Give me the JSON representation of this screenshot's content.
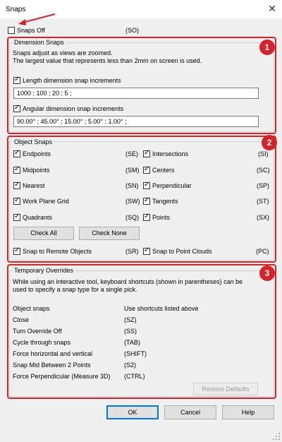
{
  "window": {
    "title": "Snaps",
    "close_glyph": "✕"
  },
  "snaps_off": {
    "label": "Snaps Off",
    "shortcut": "(SO)",
    "checked": false
  },
  "dimension": {
    "legend": "Dimension Snaps",
    "desc1": "Snaps adjust as views are zoomed.",
    "desc2": "The largest value that represents less than 2mm on screen is used.",
    "length_label": "Length dimension snap increments",
    "length_value": "1000 ; 100 ; 20 ; 5 ;",
    "angular_label": "Angular dimension snap increments",
    "angular_value": "90.00° ; 45.00° ; 15.00° ; 5.00° ; 1.00° ;"
  },
  "object": {
    "legend": "Object Snaps",
    "left": [
      {
        "label": "Endpoints",
        "shortcut": "(SE)"
      },
      {
        "label": "Midpoints",
        "shortcut": "(SM)"
      },
      {
        "label": "Nearest",
        "shortcut": "(SN)"
      },
      {
        "label": "Work Plane Grid",
        "shortcut": "(SW)"
      },
      {
        "label": "Quadrants",
        "shortcut": "(SQ)"
      }
    ],
    "right": [
      {
        "label": "Intersections",
        "shortcut": "(SI)"
      },
      {
        "label": "Centers",
        "shortcut": "(SC)"
      },
      {
        "label": "Perpendicular",
        "shortcut": "(SP)"
      },
      {
        "label": "Tangents",
        "shortcut": "(ST)"
      },
      {
        "label": "Points",
        "shortcut": "(SX)"
      }
    ],
    "check_all": "Check All",
    "check_none": "Check None",
    "remote": {
      "label": "Snap to Remote Objects",
      "shortcut": "(SR)"
    },
    "clouds": {
      "label": "Snap to Point Clouds",
      "shortcut": "(PC)"
    }
  },
  "temporary": {
    "legend": "Temporary Overrides",
    "desc1": "While using an interactive tool, keyboard shortcuts (shown in parentheses) can be",
    "desc2": "used to specify a snap type for a single pick.",
    "rows": [
      {
        "name": "Object snaps",
        "value": "Use shortcuts listed above"
      },
      {
        "name": "Close",
        "value": "(SZ)"
      },
      {
        "name": "Turn Override Off",
        "value": "(SS)"
      },
      {
        "name": "Cycle through snaps",
        "value": "(TAB)"
      },
      {
        "name": "Force horizontal and vertical",
        "value": "(SHIFT)"
      },
      {
        "name": "Snap Mid Between 2 Points",
        "value": "(S2)"
      },
      {
        "name": "Force Perpendicular (Measure 3D)",
        "value": "(CTRL)"
      }
    ],
    "restore": "Restore Defaults"
  },
  "footer": {
    "ok": "OK",
    "cancel": "Cancel",
    "help": "Help"
  },
  "badges": {
    "b1": "1",
    "b2": "2",
    "b3": "3"
  },
  "colors": {
    "annotation_red": "#d6232a",
    "primary_blue": "#0078d7"
  }
}
